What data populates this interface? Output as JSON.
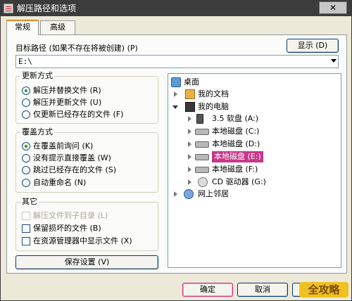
{
  "window": {
    "title": "解压路径和选项",
    "close_label": "✕"
  },
  "tabs": [
    {
      "label": "常规"
    },
    {
      "label": "高级"
    }
  ],
  "target_path": {
    "label": "目标路径 (如果不存在将被创建) (P)",
    "value": "E:\\",
    "show_button": "显示 (D)"
  },
  "update_mode": {
    "title": "更新方式",
    "options": [
      {
        "label": "解压并替换文件 (R)",
        "checked": true
      },
      {
        "label": "解压并更新文件 (U)",
        "checked": false
      },
      {
        "label": "仅更新已经存在的文件 (F)",
        "checked": false
      }
    ]
  },
  "overwrite_mode": {
    "title": "覆盖方式",
    "options": [
      {
        "label": "在覆盖前询问 (K)",
        "checked": true
      },
      {
        "label": "没有提示直接覆盖 (W)",
        "checked": false
      },
      {
        "label": "跳过已经存在的文件 (S)",
        "checked": false
      },
      {
        "label": "自动重命名 (N)",
        "checked": false
      }
    ]
  },
  "misc": {
    "title": "其它",
    "options": [
      {
        "label": "解压文件到子目录 (L)",
        "checked": false,
        "disabled": true
      },
      {
        "label": "保留损坏的文件 (B)",
        "checked": false,
        "disabled": false
      },
      {
        "label": "在资源管理器中显示文件 (X)",
        "checked": false,
        "disabled": false
      }
    ]
  },
  "save_settings_button": "保存设置 (V)",
  "tree": {
    "items": [
      {
        "label": "桌面",
        "icon": "desktop-icon"
      },
      {
        "label": "我的文档",
        "icon": "my-documents-icon"
      },
      {
        "label": "我的电脑",
        "icon": "my-computer-icon"
      },
      {
        "label": "3.5 软盘 (A:)",
        "icon": "floppy-icon"
      },
      {
        "label": "本地磁盘 (C:)",
        "icon": "hard-disk-icon"
      },
      {
        "label": "本地磁盘 (D:)",
        "icon": "hard-disk-icon"
      },
      {
        "label": "本地磁盘 (E:)",
        "icon": "hard-disk-icon",
        "selected": true
      },
      {
        "label": "本地磁盘 (F:)",
        "icon": "hard-disk-icon"
      },
      {
        "label": "CD 驱动器 (G:)",
        "icon": "cd-drive-icon"
      },
      {
        "label": "网上邻居",
        "icon": "network-icon"
      }
    ]
  },
  "footer": {
    "ok": "确定",
    "cancel": "取消",
    "help": "帮助"
  },
  "watermark": "全攻略",
  "colors": {
    "accent_selection": "#c8378a",
    "titlebar": "#3c3c3c",
    "dialog_bg": "#ece9d8"
  }
}
